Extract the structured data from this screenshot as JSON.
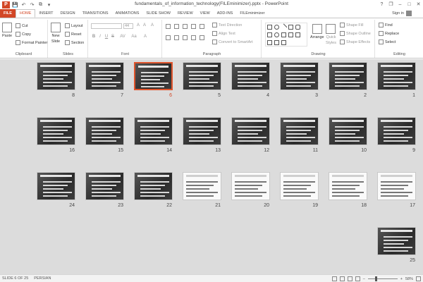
{
  "app": {
    "logo_letter": "P",
    "title": "fundamentals_of_information_technology(FILEminimizer).pptx - PowerPoint",
    "accent": "#d24726"
  },
  "window_controls": {
    "help": "?",
    "restore": "❐",
    "minimize": "–",
    "maximize": "□",
    "close": "✕"
  },
  "qat": {
    "save": "💾",
    "undo": "↶",
    "redo": "↷",
    "start": "⧉",
    "more": "▾"
  },
  "tabs": [
    "FILE",
    "HOME",
    "INSERT",
    "DESIGN",
    "TRANSITIONS",
    "ANIMATIONS",
    "SLIDE SHOW",
    "REVIEW",
    "VIEW",
    "ADD-INS",
    "FILEminimizer"
  ],
  "active_tab": "HOME",
  "signin": "Sign in",
  "ribbon": {
    "clipboard": {
      "paste": "Paste",
      "cut": "Cut",
      "copy": "Copy",
      "format_painter": "Format Painter",
      "label": "Clipboard"
    },
    "slides": {
      "new_slide": "New",
      "new_slide2": "Slide",
      "layout": "Layout",
      "reset": "Reset",
      "section": "Section",
      "label": "Slides"
    },
    "font": {
      "size": "44",
      "grow": "A",
      "shrink": "A",
      "clear": "A",
      "bold": "B",
      "italic": "I",
      "underline": "U",
      "strike": "S",
      "spacing": "AV",
      "case": "Aa",
      "color": "A",
      "label": "Font"
    },
    "paragraph": {
      "text_direction": "Text Direction",
      "align_text": "Align Text",
      "smartart": "Convert to SmartArt",
      "label": "Paragraph"
    },
    "drawing": {
      "arrange": "Arrange",
      "quick": "Quick",
      "styles": "Styles",
      "shape_fill": "Shape Fill",
      "shape_outline": "Shape Outline",
      "shape_effects": "Shape Effects",
      "label": "Drawing"
    },
    "editing": {
      "find": "Find",
      "replace": "Replace",
      "select": "Select",
      "label": "Editing"
    }
  },
  "slides": [
    {
      "num": "1"
    },
    {
      "num": "2"
    },
    {
      "num": "3"
    },
    {
      "num": "4"
    },
    {
      "num": "5"
    },
    {
      "num": "6"
    },
    {
      "num": "7"
    },
    {
      "num": "8"
    },
    {
      "num": "9"
    },
    {
      "num": "10"
    },
    {
      "num": "11"
    },
    {
      "num": "12"
    },
    {
      "num": "13"
    },
    {
      "num": "14"
    },
    {
      "num": "15"
    },
    {
      "num": "16"
    },
    {
      "num": "17"
    },
    {
      "num": "18"
    },
    {
      "num": "19"
    },
    {
      "num": "20"
    },
    {
      "num": "21"
    },
    {
      "num": "22"
    },
    {
      "num": "23"
    },
    {
      "num": "24"
    },
    {
      "num": "25"
    }
  ],
  "selected_slide": "6",
  "status": {
    "slide_info": "SLIDE 6 OF 25",
    "language": "PERSIAN",
    "zoom": "58%",
    "zoom_minus": "–",
    "zoom_plus": "+"
  }
}
